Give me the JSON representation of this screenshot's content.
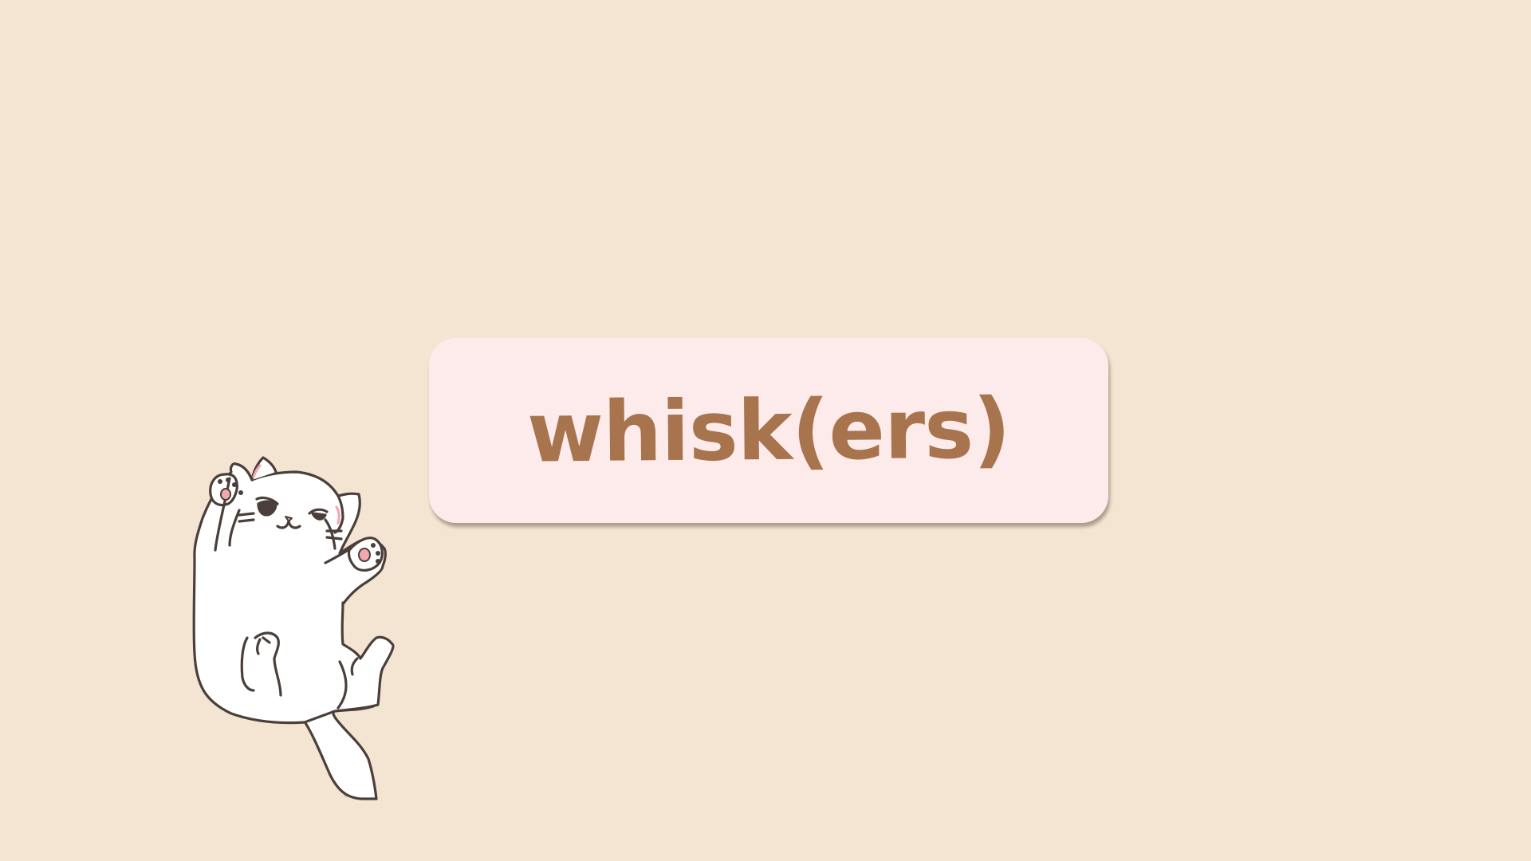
{
  "slide": {
    "title": "whisk(ers)"
  },
  "colors": {
    "background": "#f4e4d2",
    "card": "#fdebeb",
    "title_text": "#a8744e",
    "cat_outline": "#4a3f3a",
    "cat_body": "#ffffff",
    "cat_shadow": "#cfcac6",
    "paw_pad": "#f2a7b1"
  },
  "illustration": {
    "icon": "cat-illustration"
  }
}
